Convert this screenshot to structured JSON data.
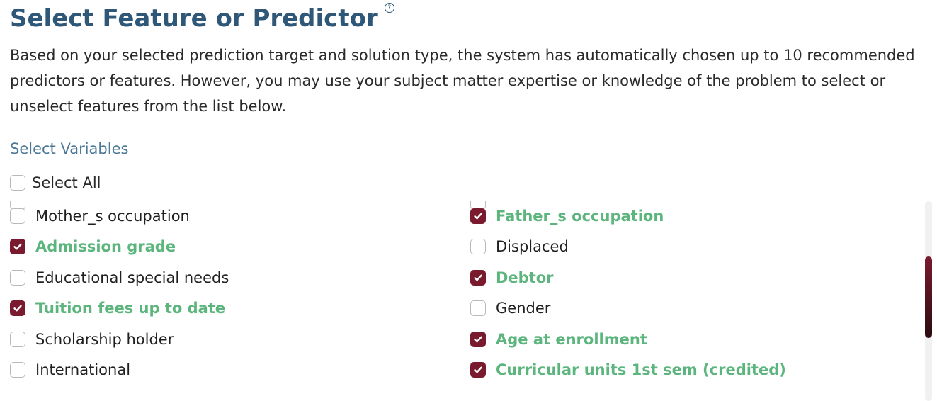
{
  "header": {
    "title": "Select Feature or Predictor",
    "help_icon": "?",
    "description": "Based on your selected prediction target and solution type, the system has automatically chosen up to 10 recommended predictors or features. However, you may use your subject matter expertise or knowledge of the problem to select or unselect features from the list below."
  },
  "variables": {
    "section_label": "Select Variables",
    "select_all_label": "Select All",
    "select_all_checked": false,
    "left_column": [
      {
        "label": "Mother_s occupation",
        "checked": false
      },
      {
        "label": "Admission grade",
        "checked": true
      },
      {
        "label": "Educational special needs",
        "checked": false
      },
      {
        "label": "Tuition fees up to date",
        "checked": true
      },
      {
        "label": "Scholarship holder",
        "checked": false
      },
      {
        "label": "International",
        "checked": false
      }
    ],
    "right_column": [
      {
        "label": "Father_s occupation",
        "checked": true
      },
      {
        "label": "Displaced",
        "checked": false
      },
      {
        "label": "Debtor",
        "checked": true
      },
      {
        "label": "Gender",
        "checked": false
      },
      {
        "label": "Age at enrollment",
        "checked": true
      },
      {
        "label": "Curricular units 1st sem (credited)",
        "checked": true
      }
    ]
  },
  "colors": {
    "title": "#2f5878",
    "section_label": "#4a7896",
    "checked_box": "#7a1a2e",
    "checked_label": "#5cb57d"
  }
}
